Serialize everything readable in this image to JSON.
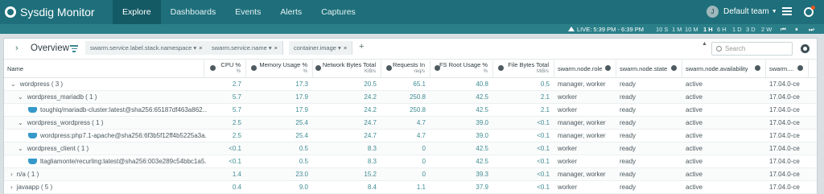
{
  "app": {
    "title": "Sysdig Monitor"
  },
  "nav": {
    "tabs": [
      {
        "label": "Explore",
        "active": true
      },
      {
        "label": "Dashboards",
        "active": false
      },
      {
        "label": "Events",
        "active": false
      },
      {
        "label": "Alerts",
        "active": false
      },
      {
        "label": "Captures",
        "active": false
      }
    ],
    "user_initial": "J",
    "team": "Default team"
  },
  "timebar": {
    "live": "LIVE: 5:39 PM - 6:39 PM",
    "options": [
      "10 S",
      "1 M",
      "10 M",
      "1 H",
      "6 H",
      "1 D",
      "3 D",
      "2 W"
    ],
    "active_option": "1 H",
    "controls": [
      "⏮",
      "⏸",
      "⏭"
    ]
  },
  "panel": {
    "title": "Overview",
    "crumbs": [
      "swarm.service.label.stack.namespace",
      "swarm.service.name",
      "container.image"
    ],
    "search_placeholder": "Search"
  },
  "table": {
    "columns": [
      {
        "label": "Name",
        "unit": ""
      },
      {
        "label": "CPU %",
        "unit": "%"
      },
      {
        "label": "Memory Usage %",
        "unit": "%"
      },
      {
        "label": "Network Bytes Total",
        "unit": "KiB/s"
      },
      {
        "label": "Requests In",
        "unit": "req/s"
      },
      {
        "label": "FS Root Usage %",
        "unit": "%"
      },
      {
        "label": "File Bytes Total",
        "unit": "MiB/s"
      },
      {
        "label": "swarm.node.role",
        "unit": ""
      },
      {
        "label": "swarm.node.state",
        "unit": ""
      },
      {
        "label": "swarm.node.availability",
        "unit": ""
      },
      {
        "label": "swarm....",
        "unit": ""
      }
    ],
    "rows": [
      {
        "name": "wordpress ( 3 )",
        "level": 0,
        "kind": "group",
        "cpu": "2.7",
        "mem": "17.3",
        "net": "20.5",
        "req": "65.1",
        "fs": "40.8",
        "file": "0.5",
        "role": "manager, worker",
        "state": "ready",
        "avail": "active",
        "ver": "17.04.0-ce"
      },
      {
        "name": "wordpress_mariadb ( 1 )",
        "level": 1,
        "kind": "group",
        "cpu": "5.7",
        "mem": "17.9",
        "net": "24.2",
        "req": "250.8",
        "fs": "42.5",
        "file": "2.1",
        "role": "worker",
        "state": "ready",
        "avail": "active",
        "ver": "17.04.0-ce"
      },
      {
        "name": "toughiq/mariadb-cluster:latest@sha256:65187df463a862...",
        "level": 2,
        "kind": "container",
        "cpu": "5.7",
        "mem": "17.9",
        "net": "24.2",
        "req": "250.8",
        "fs": "42.5",
        "file": "2.1",
        "role": "worker",
        "state": "ready",
        "avail": "active",
        "ver": "17.04.0-ce"
      },
      {
        "name": "wordpress_wordpress ( 1 )",
        "level": 1,
        "kind": "group",
        "cpu": "2.5",
        "mem": "25.4",
        "net": "24.7",
        "req": "4.7",
        "fs": "39.0",
        "file": "<0.1",
        "role": "manager, worker",
        "state": "ready",
        "avail": "active",
        "ver": "17.04.0-ce"
      },
      {
        "name": "wordpress:php7.1-apache@sha256:6f3b5f12ff4b5225a3a...",
        "level": 2,
        "kind": "container",
        "cpu": "2.5",
        "mem": "25.4",
        "net": "24.7",
        "req": "4.7",
        "fs": "39.0",
        "file": "<0.1",
        "role": "manager, worker",
        "state": "ready",
        "avail": "active",
        "ver": "17.04.0-ce"
      },
      {
        "name": "wordpress_client ( 1 )",
        "level": 1,
        "kind": "group",
        "cpu": "<0.1",
        "mem": "0.5",
        "net": "8.3",
        "req": "0",
        "fs": "42.5",
        "file": "<0.1",
        "role": "worker",
        "state": "ready",
        "avail": "active",
        "ver": "17.04.0-ce"
      },
      {
        "name": "ltagliamonte/recurling:latest@sha256:003e289c54bbc1a5...",
        "level": 2,
        "kind": "container",
        "cpu": "<0.1",
        "mem": "0.5",
        "net": "8.3",
        "req": "0",
        "fs": "42.5",
        "file": "<0.1",
        "role": "worker",
        "state": "ready",
        "avail": "active",
        "ver": "17.04.0-ce"
      },
      {
        "name": "n/a ( 1 )",
        "level": 0,
        "kind": "collapsed",
        "cpu": "1.4",
        "mem": "23.0",
        "net": "15.2",
        "req": "0",
        "fs": "39.3",
        "file": "<0.1",
        "role": "manager, worker",
        "state": "ready",
        "avail": "active",
        "ver": "17.04.0-ce"
      },
      {
        "name": "javaapp ( 5 )",
        "level": 0,
        "kind": "collapsed",
        "cpu": "0.4",
        "mem": "9.0",
        "net": "8.4",
        "req": "1.1",
        "fs": "37.9",
        "file": "<0.1",
        "role": "worker",
        "state": "ready",
        "avail": "active",
        "ver": "17.04.0-ce"
      }
    ]
  }
}
